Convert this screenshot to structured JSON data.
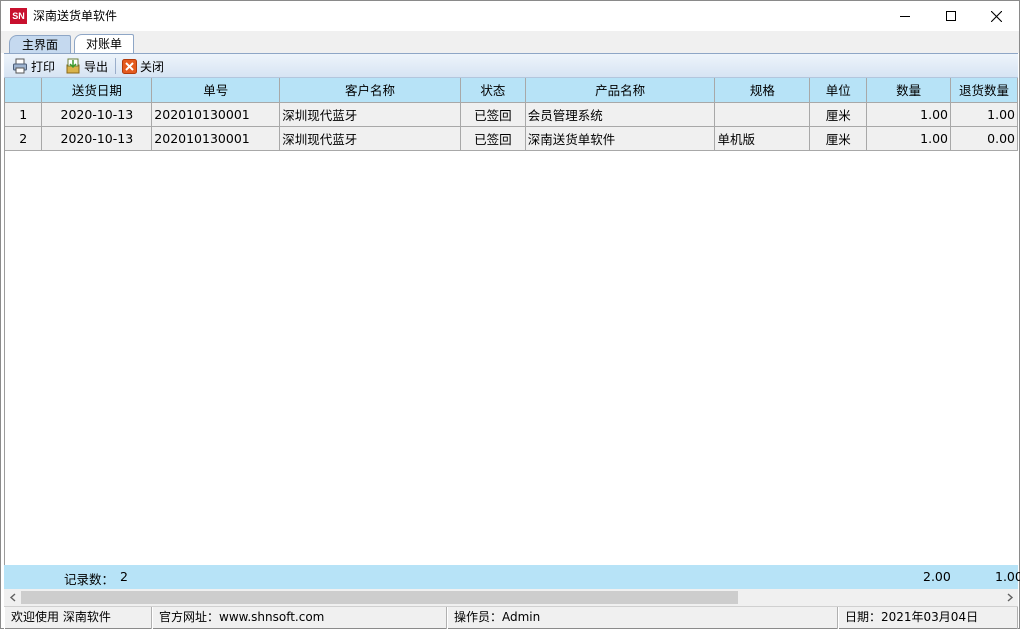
{
  "window": {
    "logo_text": "SN",
    "title": "深南送货单软件"
  },
  "tabs": [
    {
      "label": "主界面"
    },
    {
      "label": "对账单"
    }
  ],
  "toolbar": {
    "print_label": "打印",
    "export_label": "导出",
    "close_label": "关闭"
  },
  "table": {
    "headers": [
      "",
      "送货日期",
      "单号",
      "客户名称",
      "状态",
      "产品名称",
      "规格",
      "单位",
      "数量",
      "退货数量"
    ],
    "rows": [
      {
        "idx": "1",
        "date": "2020-10-13",
        "order_no": "202010130001",
        "customer": "深圳现代蓝牙",
        "status": "已签回",
        "product": "会员管理系统",
        "spec": "",
        "unit": "厘米",
        "qty": "1.00",
        "return_qty": "1.00"
      },
      {
        "idx": "2",
        "date": "2020-10-13",
        "order_no": "202010130001",
        "customer": "深圳现代蓝牙",
        "status": "已签回",
        "product": "深南送货单软件",
        "spec": "单机版",
        "unit": "厘米",
        "qty": "1.00",
        "return_qty": "0.00"
      }
    ]
  },
  "summary": {
    "record_label": "记录数：",
    "record_count": "2",
    "qty_total": "2.00",
    "return_total": "1.00"
  },
  "statusbar": {
    "welcome": "欢迎使用 深南软件",
    "website": "官方网址：www.shnsoft.com",
    "operator": "操作员：Admin",
    "date": "日期：2021年03月04日"
  }
}
